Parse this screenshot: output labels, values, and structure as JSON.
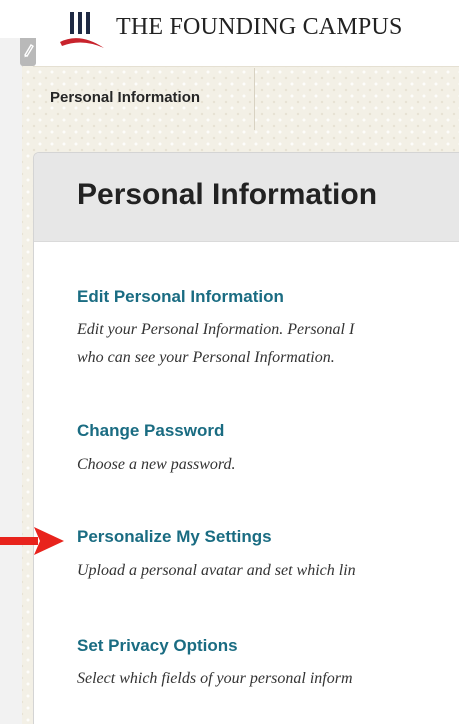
{
  "header": {
    "logo_text": "THE FOUNDING CAMPUS",
    "logo_icon": "university-columns-icon"
  },
  "edit_strip": {
    "icon": "pencil-icon"
  },
  "breadcrumb": {
    "current": "Personal Information"
  },
  "page": {
    "title": "Personal Information"
  },
  "options": [
    {
      "link": "Edit Personal Information",
      "desc_line1": "Edit your Personal Information. Personal I",
      "desc_line2": "who can see your Personal Information."
    },
    {
      "link": "Change Password",
      "desc_line1": "Choose a new password."
    },
    {
      "link": "Personalize My Settings",
      "desc_line1": "Upload a personal avatar and set which lin"
    },
    {
      "link": "Set Privacy Options",
      "desc_line1": "Select which fields of your personal inform"
    }
  ],
  "annotation": {
    "arrow_color": "#e8231c",
    "points_to": "Personalize My Settings"
  },
  "colors": {
    "link": "#1a6c82",
    "title": "#222222",
    "header_bg": "#e7e7e7",
    "pattern_bg": "#f3f0e6",
    "logo_red": "#c8232c",
    "logo_navy": "#1f2a44"
  }
}
